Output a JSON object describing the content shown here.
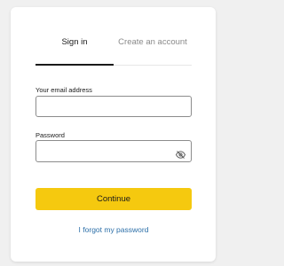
{
  "tabs": {
    "signin": "Sign in",
    "create": "Create an account"
  },
  "email": {
    "label": "Your email address",
    "value": "",
    "placeholder": ""
  },
  "password": {
    "label": "Password",
    "value": "",
    "placeholder": ""
  },
  "icons": {
    "password_toggle": "eye-off-icon"
  },
  "continue_label": "Continue",
  "forgot_label": "I forgot my password",
  "colors": {
    "accent": "#f5c90f",
    "link": "#2c6fa8",
    "background": "#f0f0f0"
  }
}
